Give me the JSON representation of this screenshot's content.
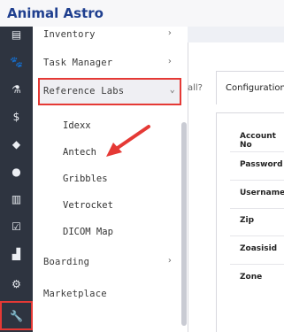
{
  "app": {
    "title": "Animal Astro"
  },
  "menu": {
    "items": [
      {
        "label": "Inventory"
      },
      {
        "label": "Task Manager"
      },
      {
        "label": "Reference Labs"
      },
      {
        "label": "Boarding"
      },
      {
        "label": "Marketplace"
      }
    ],
    "reference_labs": [
      "Idexx",
      "Antech",
      "Gribbles",
      "Vetrocket",
      "DICOM Map"
    ]
  },
  "tabs": {
    "partial_left": "all?",
    "configuration": "Configuration"
  },
  "config_fields": [
    "Account No",
    "Password",
    "Username",
    "Zip",
    "Zoasisid",
    "Zone"
  ],
  "icons": [
    "menu-icon",
    "paw-icon",
    "lab-flask-icon",
    "dollar-icon",
    "dropbox-icon",
    "chat-icon",
    "document-icon",
    "checkbox-icon",
    "chart-icon",
    "gear-icon",
    "wrench-icon"
  ]
}
